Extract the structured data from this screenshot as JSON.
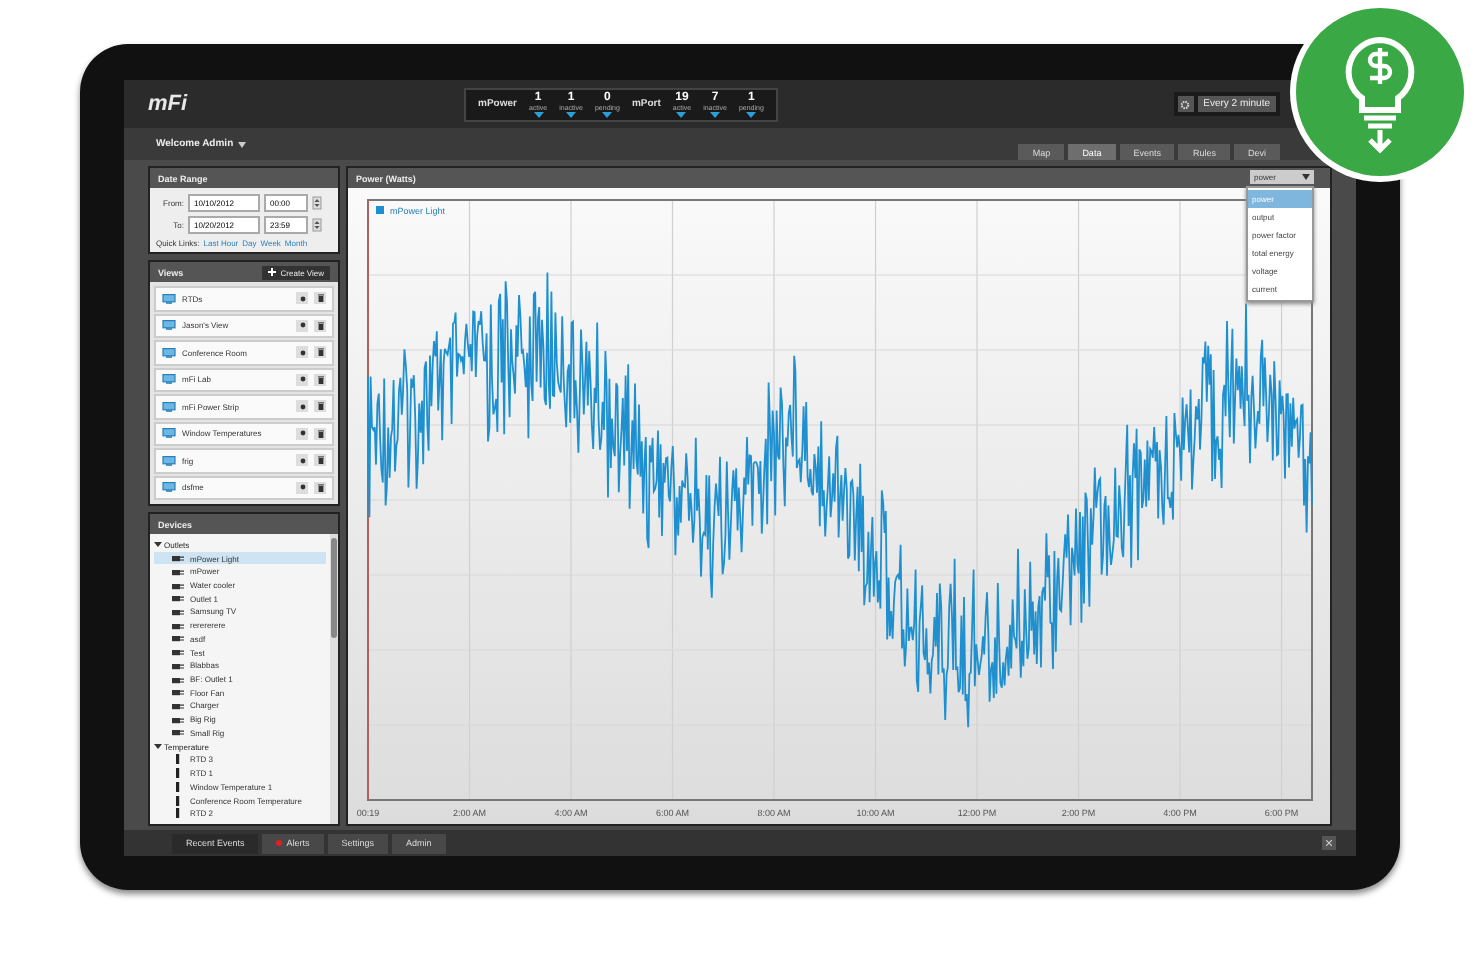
{
  "header": {
    "logo": "mFi",
    "groups": [
      {
        "name": "mPower",
        "counters": [
          {
            "value": "1",
            "label": "active"
          },
          {
            "value": "1",
            "label": "inactive"
          },
          {
            "value": "0",
            "label": "pending"
          }
        ]
      },
      {
        "name": "mPort",
        "counters": [
          {
            "value": "19",
            "label": "active"
          },
          {
            "value": "7",
            "label": "inactive"
          },
          {
            "value": "1",
            "label": "pending"
          }
        ]
      }
    ],
    "refresh": "Every 2 minute"
  },
  "welcome": "Welcome Admin",
  "tabs": [
    {
      "label": "Map",
      "selected": false
    },
    {
      "label": "Data",
      "selected": true
    },
    {
      "label": "Events",
      "selected": false
    },
    {
      "label": "Rules",
      "selected": false
    },
    {
      "label": "Devi",
      "selected": false
    }
  ],
  "date_range": {
    "title": "Date Range",
    "from_label": "From:",
    "from_date": "10/10/2012",
    "from_time": "00:00",
    "to_label": "To:",
    "to_date": "10/20/2012",
    "to_time": "23:59",
    "quick_links_label": "Quick Links:",
    "quick_links": [
      "Last Hour",
      "Day",
      "Week",
      "Month"
    ]
  },
  "views": {
    "title": "Views",
    "create_button": "Create View",
    "items": [
      "RTDs",
      "Jason's View",
      "Conference Room",
      "mFi Lab",
      "mFi Power Strip",
      "Window Temperatures",
      "frig",
      "dsfme"
    ]
  },
  "devices": {
    "title": "Devices",
    "groups": [
      {
        "label": "Outlets",
        "kind": "outlet",
        "expanded": true,
        "children": [
          {
            "label": "mPower Light",
            "selected": true
          },
          {
            "label": "mPower",
            "selected": false
          },
          {
            "label": "Water cooler",
            "selected": false
          },
          {
            "label": "Outlet 1",
            "selected": false
          },
          {
            "label": "Samsung TV",
            "selected": false
          },
          {
            "label": "rerererere",
            "selected": false
          },
          {
            "label": "asdf",
            "selected": false
          },
          {
            "label": "Test",
            "selected": false
          },
          {
            "label": "Blabbas",
            "selected": false
          },
          {
            "label": "BF: Outlet 1",
            "selected": false
          },
          {
            "label": "Floor Fan",
            "selected": false
          },
          {
            "label": "Charger",
            "selected": false
          },
          {
            "label": "Big Rig",
            "selected": false
          },
          {
            "label": "Small Rig",
            "selected": false
          }
        ]
      },
      {
        "label": "Temperature",
        "kind": "sensor",
        "expanded": true,
        "children": [
          {
            "label": "RTD 3",
            "selected": false
          },
          {
            "label": "RTD 1",
            "selected": false
          },
          {
            "label": "Window Temperature 1",
            "selected": false
          },
          {
            "label": "Conference Room Temperature",
            "selected": false
          },
          {
            "label": "RTD 2",
            "selected": false
          }
        ]
      }
    ]
  },
  "chart": {
    "title": "Power (Watts)",
    "legend": "mPower Light",
    "x_labels": [
      "00:19",
      "2:00 AM",
      "4:00 AM",
      "6:00 AM",
      "8:00 AM",
      "10:00 AM",
      "12:00 PM",
      "2:00 PM",
      "4:00 PM",
      "6:00 PM"
    ]
  },
  "metric_select": {
    "value": "power",
    "expanded": true,
    "options": [
      {
        "label": "power",
        "selected": true
      },
      {
        "label": "output",
        "selected": false
      },
      {
        "label": "power factor",
        "selected": false
      },
      {
        "label": "total energy",
        "selected": false
      },
      {
        "label": "voltage",
        "selected": false
      },
      {
        "label": "current",
        "selected": false
      }
    ]
  },
  "bottom_tabs": [
    {
      "label": "Recent Events",
      "selected": true,
      "alert": false
    },
    {
      "label": "Alerts",
      "selected": false,
      "alert": true
    },
    {
      "label": "Settings",
      "selected": false,
      "alert": false
    },
    {
      "label": "Admin",
      "selected": false,
      "alert": false
    }
  ]
}
